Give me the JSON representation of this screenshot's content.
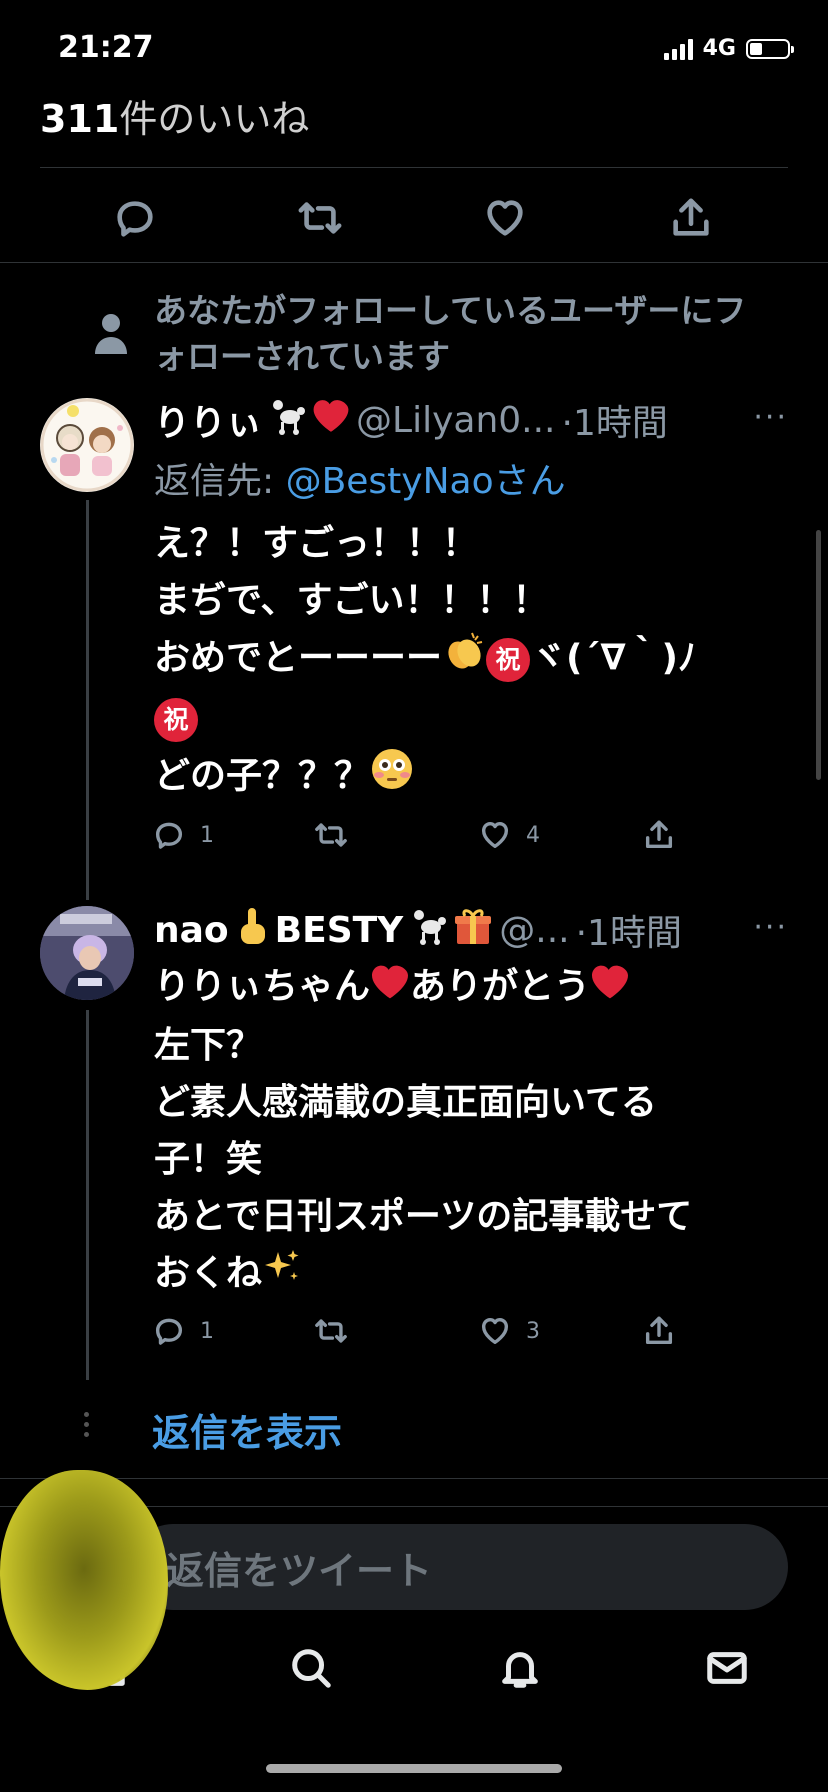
{
  "status_bar": {
    "time": "21:27",
    "network": "4G",
    "battery_level": 0.3
  },
  "likes": {
    "count": "311",
    "suffix": "件のいいね"
  },
  "main_actions": {
    "icons": [
      "reply-icon",
      "retweet-icon",
      "like-icon",
      "share-icon"
    ]
  },
  "social_context": "あなたがフォローしているユーザーにフォローされています",
  "replies": [
    {
      "name": "りりぃ",
      "handle": "@Lilyan0...",
      "time": "·1時間",
      "more": "···",
      "reply_to_prefix": "返信先: ",
      "reply_to_mention": "@BestyNaoさん",
      "lines": [
        "え？！すごっ！！！",
        "まぢで、すごい！！！！",
        "おめでとーーーー",
        "ヾ(´∇｀)ﾉ",
        "どの子？？？"
      ],
      "badge_text": "祝",
      "reply_count": "1",
      "like_count": "4"
    },
    {
      "name": "nao",
      "name2": "BESTY",
      "handle": "@...",
      "time": "·1時間",
      "more": "···",
      "lines": [
        "りりぃちゃん",
        "ありがとう",
        "左下？",
        "ど素人感満載の真正面向いてる",
        "子！笑",
        "あとで日刊スポーツの記事載せて",
        "おくね"
      ],
      "reply_count": "1",
      "like_count": "3"
    }
  ],
  "show_replies": "返信を表示",
  "reply_box": {
    "placeholder": "返信をツイート"
  },
  "colors": {
    "background": "#000000",
    "link": "#4a9de4",
    "muted": "#8b98a5",
    "heart": "#e0243a"
  }
}
